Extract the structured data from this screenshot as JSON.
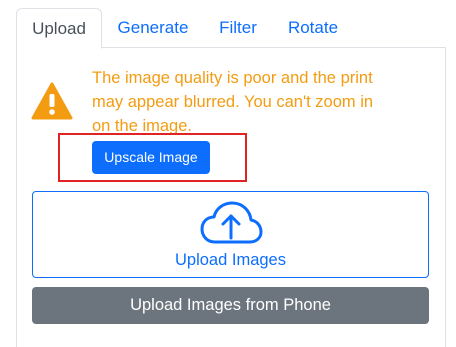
{
  "tabs": [
    {
      "label": "Upload",
      "active": true
    },
    {
      "label": "Generate",
      "active": false
    },
    {
      "label": "Filter",
      "active": false
    },
    {
      "label": "Rotate",
      "active": false
    }
  ],
  "warning": {
    "icon": "warning-triangle-icon",
    "text": "The image quality is poor and the print may appear blurred. You can't zoom in on the image.",
    "color": "#f39c12"
  },
  "upscale_button": {
    "label": "Upscale Image"
  },
  "upload_box": {
    "icon": "cloud-upload-icon",
    "label": "Upload Images"
  },
  "phone_button": {
    "label": "Upload Images from Phone"
  },
  "colors": {
    "primary": "#0d6efd",
    "secondary": "#6c757d",
    "warning": "#f39c12",
    "highlight": "#e02424"
  }
}
